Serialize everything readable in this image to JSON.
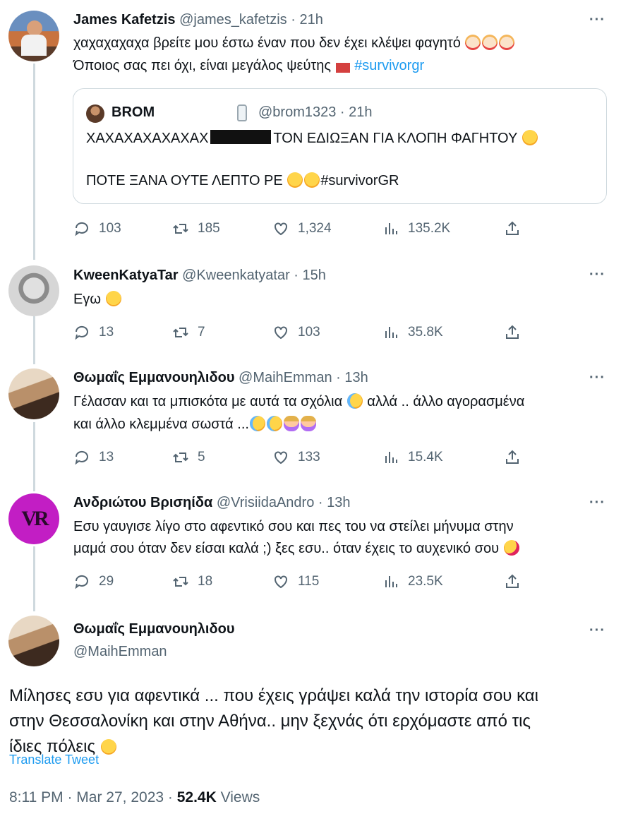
{
  "tweets": [
    {
      "name": "James Kafetzis",
      "handle": "@james_kafetzis",
      "time": "21h",
      "line1": "χαχαχαχαχα βρείτε μου έστω έναν που δεν έχει κλέψει φαγητό",
      "line2": "Όποιος σας πει όχι, είναι μεγάλος ψεύτης",
      "hashtag": "#survivorgr",
      "quote": {
        "name": "BROM",
        "handle": "@brom1323",
        "time": "21h",
        "line1_a": "ΧΑΧΑΧΑΧΑΧΑΧΑΧ",
        "line1_b": "ΤΟΝ ΕΔΙΩΞΑΝ ΓΙΑ ΚΛΟΠΗ ΦΑΓΗΤΟΥ",
        "line2": "ΠΟΤΕ ΞΑΝΑ ΟΥΤΕ ΛΕΠΤΟ ΡΕ",
        "hashtag": "#survivorGR"
      },
      "replies": "103",
      "retweets": "185",
      "likes": "1,324",
      "views": "135.2K"
    },
    {
      "name": "KweenKatyaTar",
      "handle": "@Kweenkatyatar",
      "time": "15h",
      "line1": "Εγω",
      "replies": "13",
      "retweets": "7",
      "likes": "103",
      "views": "35.8K"
    },
    {
      "name": "Θωμαΐς Εμμανουηλιδου",
      "handle": "@MaihEmman",
      "time": "13h",
      "line1": "Γέλασαν και τα μπισκότα με αυτά τα σχόλια",
      "line1_b": "αλλά .. άλλο αγορασμένα",
      "line2": "και άλλο κλεμμένα σωστά ...",
      "replies": "13",
      "retweets": "5",
      "likes": "133",
      "views": "15.4K"
    },
    {
      "name": "Ανδριώτου Βρισηίδα",
      "handle": "@VrisiidaAndro",
      "time": "13h",
      "avatar_text": "VR",
      "line1": "Εσυ γαυγισε λίγο στο αφεντικό σου και πες του να στείλει μήνυμα στην",
      "line2": "μαμά σου όταν δεν είσαι καλά  ;) ξες εσυ.. όταν έχεις το αυχενικό σου",
      "replies": "29",
      "retweets": "18",
      "likes": "115",
      "views": "23.5K"
    }
  ],
  "main": {
    "name": "Θωμαΐς Εμμανουηλιδου",
    "handle": "@MaihEmman",
    "line1": "Μίλησες εσυ για αφεντικά ... που έχεις γράψει καλά την ιστορία σου και",
    "line2": "στην Θεσσαλονίκη και στην Αθήνα.. μην ξεχνάς ότι ερχόμαστε από τις",
    "line3": "ίδιες πόλεις",
    "translate": "Translate Tweet",
    "timestamp": "8:11 PM · Mar 27, 2023 · ",
    "views_count": "52.4K",
    "views_label": " Views"
  },
  "more_label": "···",
  "sep": " · ",
  "colors": {
    "link": "#1d9bf0",
    "muted": "#536471",
    "line": "#cfd9de"
  }
}
